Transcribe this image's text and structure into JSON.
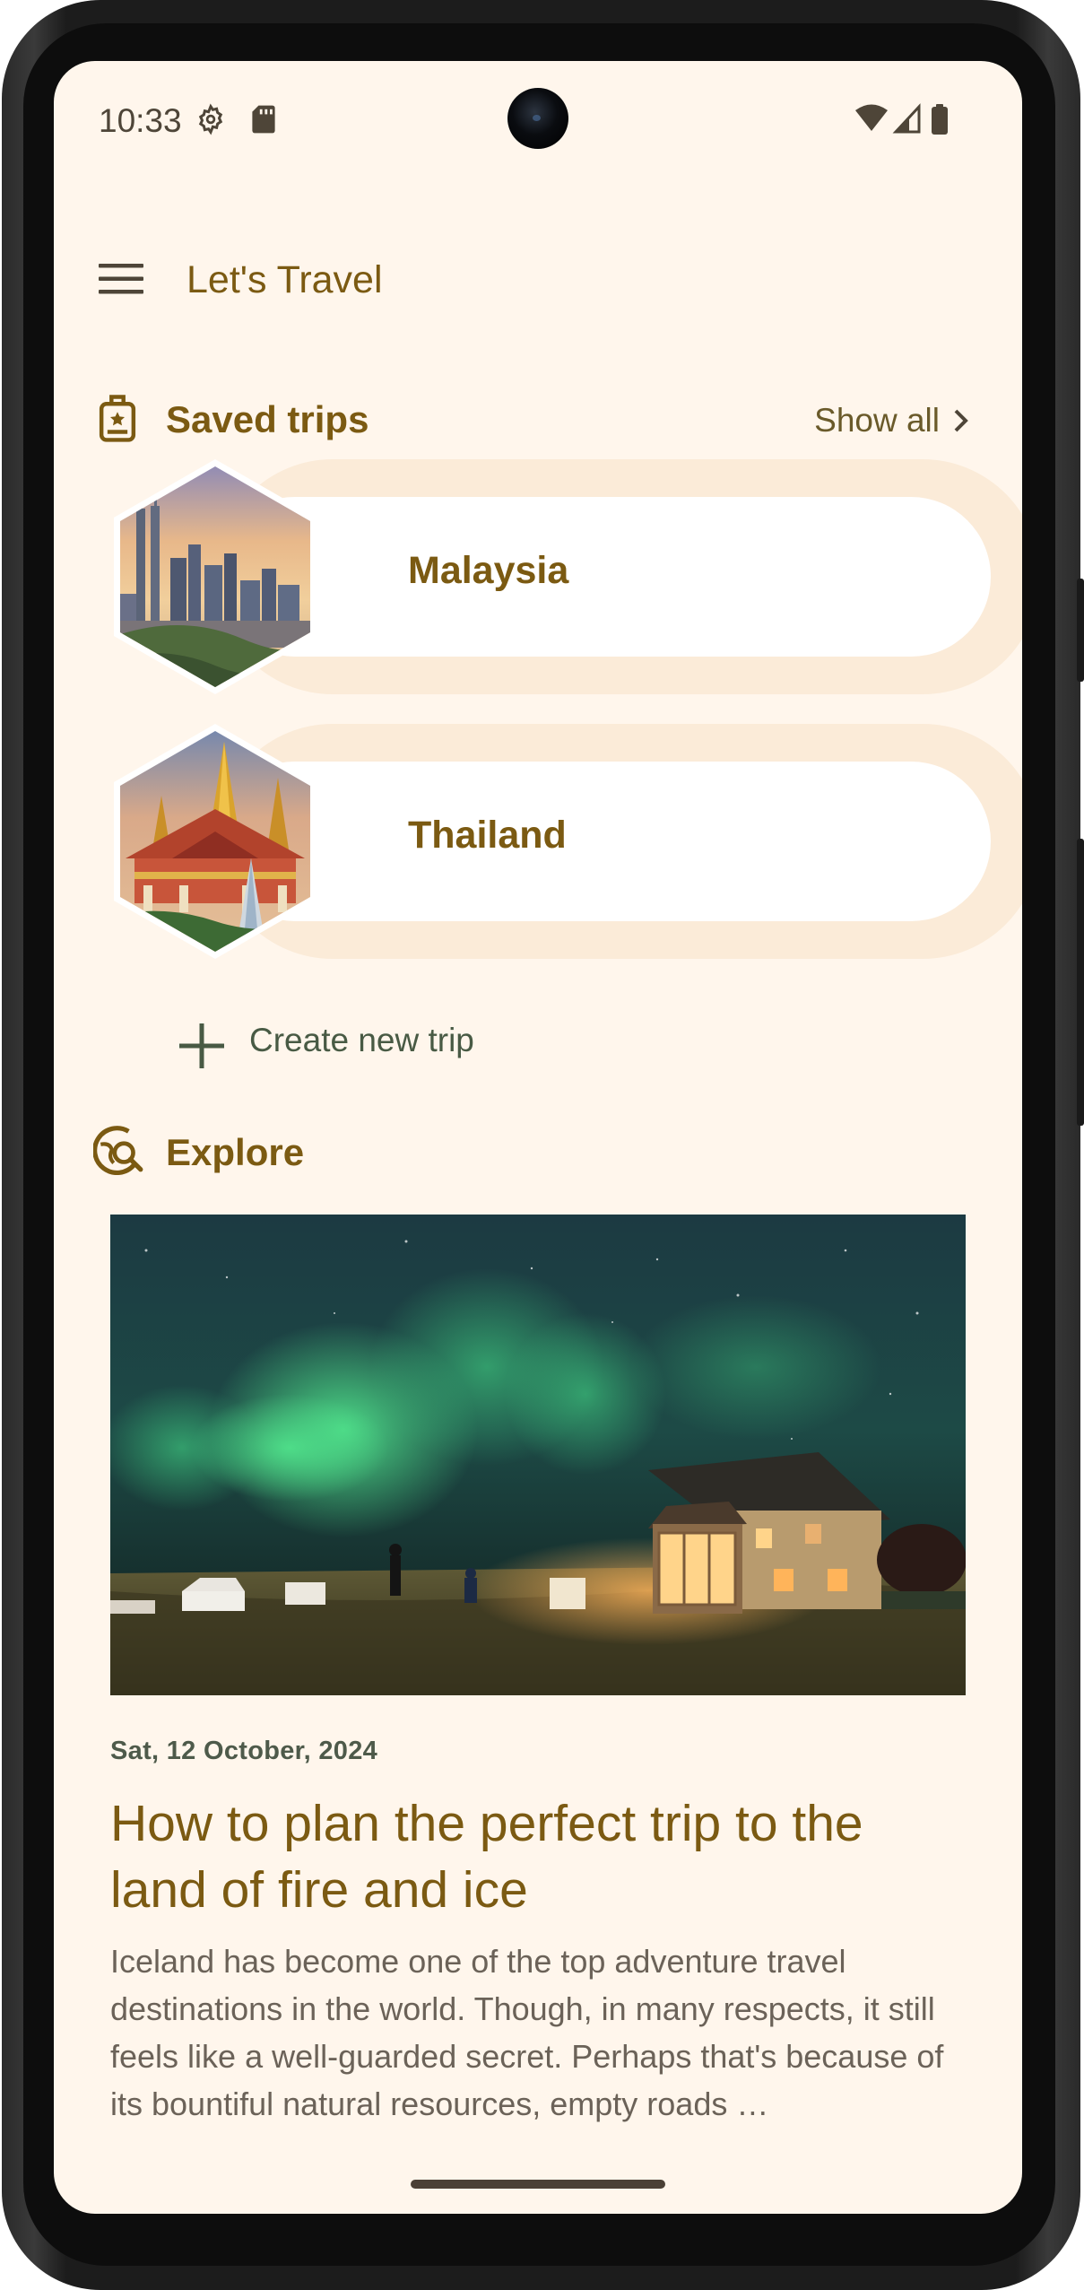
{
  "status_bar": {
    "time": "10:33",
    "icons": [
      "settings-gear-icon",
      "sd-card-icon",
      "wifi-icon",
      "cellular-signal-icon",
      "battery-icon"
    ]
  },
  "app_bar": {
    "title": "Let's Travel",
    "menu_icon": "menu-hamburger-icon"
  },
  "saved_trips": {
    "title": "Saved trips",
    "icon": "luggage-icon",
    "show_all_label": "Show all",
    "trips": [
      {
        "name": "Malaysia",
        "image": "kuala-lumpur-skyline"
      },
      {
        "name": "Thailand",
        "image": "bangkok-temple"
      }
    ]
  },
  "create_trip": {
    "label": "Create new trip",
    "icon": "plus-icon"
  },
  "explore": {
    "title": "Explore",
    "icon": "travel-explore-icon",
    "article": {
      "image": "aurora-over-house",
      "date": "Sat, 12 October, 2024",
      "title": "How to plan the perfect trip to the land of fire and ice",
      "excerpt": "Iceland has become one of the top adventure travel destinations in the world. Though, in many respects, it still feels like a well-guarded secret. Perhaps that's because of its bountiful natural resources, empty roads …"
    }
  },
  "colors": {
    "background": "#fff6ec",
    "primary": "#7b5a12",
    "card_outer": "#fbebd8",
    "card_inner": "#ffffff",
    "secondary_text": "#485a44",
    "body_text": "#6b6258"
  }
}
